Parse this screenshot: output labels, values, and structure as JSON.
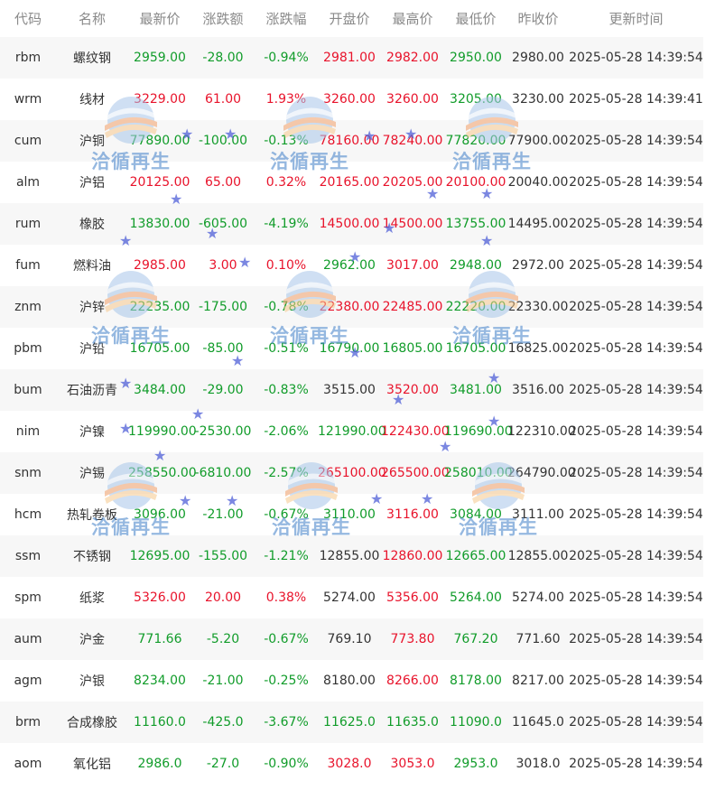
{
  "columns": [
    "代码",
    "名称",
    "最新价",
    "涨跌额",
    "涨跌幅",
    "开盘价",
    "最高价",
    "最低价",
    "昨收价",
    "更新时间"
  ],
  "colors": {
    "up": "#e8132b",
    "down": "#119c2a",
    "neutral": "#333333"
  },
  "watermark": {
    "text": "洽循再生"
  },
  "rows": [
    {
      "code": "rbm",
      "name": "螺纹钢",
      "last": "2959.00",
      "chg": "-28.00",
      "pct": "-0.94%",
      "open": "2981.00",
      "high": "2982.00",
      "low": "2950.00",
      "prev": "2980.00",
      "time": "2025-05-28 14:39:54",
      "dir": {
        "last": "down",
        "chg": "down",
        "pct": "down",
        "open": "up",
        "high": "up",
        "low": "down"
      }
    },
    {
      "code": "wrm",
      "name": "线材",
      "last": "3229.00",
      "chg": "61.00",
      "pct": "1.93%",
      "open": "3260.00",
      "high": "3260.00",
      "low": "3205.00",
      "prev": "3230.00",
      "time": "2025-05-28 14:39:41",
      "dir": {
        "last": "up",
        "chg": "up",
        "pct": "up",
        "open": "up",
        "high": "up",
        "low": "down"
      }
    },
    {
      "code": "cum",
      "name": "沪铜",
      "last": "77890.00",
      "chg": "-100.00",
      "pct": "-0.13%",
      "open": "78160.00",
      "high": "78240.00",
      "low": "77820.00",
      "prev": "77900.00",
      "time": "2025-05-28 14:39:54",
      "dir": {
        "last": "down",
        "chg": "down",
        "pct": "down",
        "open": "up",
        "high": "up",
        "low": "down"
      }
    },
    {
      "code": "alm",
      "name": "沪铝",
      "last": "20125.00",
      "chg": "65.00",
      "pct": "0.32%",
      "open": "20165.00",
      "high": "20205.00",
      "low": "20100.00",
      "prev": "20040.00",
      "time": "2025-05-28 14:39:54",
      "dir": {
        "last": "up",
        "chg": "up",
        "pct": "up",
        "open": "up",
        "high": "up",
        "low": "up"
      }
    },
    {
      "code": "rum",
      "name": "橡胶",
      "last": "13830.00",
      "chg": "-605.00",
      "pct": "-4.19%",
      "open": "14500.00",
      "high": "14500.00",
      "low": "13755.00",
      "prev": "14495.00",
      "time": "2025-05-28 14:39:54",
      "dir": {
        "last": "down",
        "chg": "down",
        "pct": "down",
        "open": "up",
        "high": "up",
        "low": "down"
      }
    },
    {
      "code": "fum",
      "name": "燃料油",
      "last": "2985.00",
      "chg": "3.00",
      "pct": "0.10%",
      "open": "2962.00",
      "high": "3017.00",
      "low": "2948.00",
      "prev": "2972.00",
      "time": "2025-05-28 14:39:54",
      "dir": {
        "last": "up",
        "chg": "up",
        "pct": "up",
        "open": "down",
        "high": "up",
        "low": "down"
      }
    },
    {
      "code": "znm",
      "name": "沪锌",
      "last": "22235.00",
      "chg": "-175.00",
      "pct": "-0.78%",
      "open": "22380.00",
      "high": "22485.00",
      "low": "22220.00",
      "prev": "22330.00",
      "time": "2025-05-28 14:39:54",
      "dir": {
        "last": "down",
        "chg": "down",
        "pct": "down",
        "open": "up",
        "high": "up",
        "low": "down"
      }
    },
    {
      "code": "pbm",
      "name": "沪铅",
      "last": "16705.00",
      "chg": "-85.00",
      "pct": "-0.51%",
      "open": "16790.00",
      "high": "16805.00",
      "low": "16705.00",
      "prev": "16825.00",
      "time": "2025-05-28 14:39:54",
      "dir": {
        "last": "down",
        "chg": "down",
        "pct": "down",
        "open": "down",
        "high": "down",
        "low": "down"
      }
    },
    {
      "code": "bum",
      "name": "石油沥青",
      "last": "3484.00",
      "chg": "-29.00",
      "pct": "-0.83%",
      "open": "3515.00",
      "high": "3520.00",
      "low": "3481.00",
      "prev": "3516.00",
      "time": "2025-05-28 14:39:54",
      "dir": {
        "last": "down",
        "chg": "down",
        "pct": "down",
        "open": "flat",
        "high": "up",
        "low": "down"
      }
    },
    {
      "code": "nim",
      "name": "沪镍",
      "last": "119990.00",
      "chg": "-2530.00",
      "pct": "-2.06%",
      "open": "121990.00",
      "high": "122430.00",
      "low": "119690.00",
      "prev": "122310.00",
      "time": "2025-05-28 14:39:54",
      "dir": {
        "last": "down",
        "chg": "down",
        "pct": "down",
        "open": "down",
        "high": "up",
        "low": "down"
      }
    },
    {
      "code": "snm",
      "name": "沪锡",
      "last": "258550.00",
      "chg": "-6810.00",
      "pct": "-2.57%",
      "open": "265100.00",
      "high": "265500.00",
      "low": "258010.00",
      "prev": "264790.00",
      "time": "2025-05-28 14:39:54",
      "dir": {
        "last": "down",
        "chg": "down",
        "pct": "down",
        "open": "up",
        "high": "up",
        "low": "down"
      }
    },
    {
      "code": "hcm",
      "name": "热轧卷板",
      "last": "3096.00",
      "chg": "-21.00",
      "pct": "-0.67%",
      "open": "3110.00",
      "high": "3116.00",
      "low": "3084.00",
      "prev": "3111.00",
      "time": "2025-05-28 14:39:54",
      "dir": {
        "last": "down",
        "chg": "down",
        "pct": "down",
        "open": "down",
        "high": "up",
        "low": "down"
      }
    },
    {
      "code": "ssm",
      "name": "不锈钢",
      "last": "12695.00",
      "chg": "-155.00",
      "pct": "-1.21%",
      "open": "12855.00",
      "high": "12860.00",
      "low": "12665.00",
      "prev": "12855.00",
      "time": "2025-05-28 14:39:54",
      "dir": {
        "last": "down",
        "chg": "down",
        "pct": "down",
        "open": "flat",
        "high": "up",
        "low": "down"
      }
    },
    {
      "code": "spm",
      "name": "纸浆",
      "last": "5326.00",
      "chg": "20.00",
      "pct": "0.38%",
      "open": "5274.00",
      "high": "5356.00",
      "low": "5264.00",
      "prev": "5274.00",
      "time": "2025-05-28 14:39:54",
      "dir": {
        "last": "up",
        "chg": "up",
        "pct": "up",
        "open": "flat",
        "high": "up",
        "low": "down"
      }
    },
    {
      "code": "aum",
      "name": "沪金",
      "last": "771.66",
      "chg": "-5.20",
      "pct": "-0.67%",
      "open": "769.10",
      "high": "773.80",
      "low": "767.20",
      "prev": "771.60",
      "time": "2025-05-28 14:39:54",
      "dir": {
        "last": "down",
        "chg": "down",
        "pct": "down",
        "open": "flat",
        "high": "up",
        "low": "down"
      }
    },
    {
      "code": "agm",
      "name": "沪银",
      "last": "8234.00",
      "chg": "-21.00",
      "pct": "-0.25%",
      "open": "8180.00",
      "high": "8266.00",
      "low": "8178.00",
      "prev": "8217.00",
      "time": "2025-05-28 14:39:54",
      "dir": {
        "last": "down",
        "chg": "down",
        "pct": "down",
        "open": "flat",
        "high": "up",
        "low": "down"
      }
    },
    {
      "code": "brm",
      "name": "合成橡胶",
      "last": "11160.0",
      "chg": "-425.0",
      "pct": "-3.67%",
      "open": "11625.0",
      "high": "11635.0",
      "low": "11090.0",
      "prev": "11645.0",
      "time": "2025-05-28 14:39:54",
      "dir": {
        "last": "down",
        "chg": "down",
        "pct": "down",
        "open": "down",
        "high": "down",
        "low": "down"
      }
    },
    {
      "code": "aom",
      "name": "氧化铝",
      "last": "2986.0",
      "chg": "-27.0",
      "pct": "-0.90%",
      "open": "3028.0",
      "high": "3053.0",
      "low": "2953.0",
      "prev": "3018.0",
      "time": "2025-05-28 14:39:54",
      "dir": {
        "last": "down",
        "chg": "down",
        "pct": "down",
        "open": "up",
        "high": "up",
        "low": "down"
      }
    }
  ]
}
